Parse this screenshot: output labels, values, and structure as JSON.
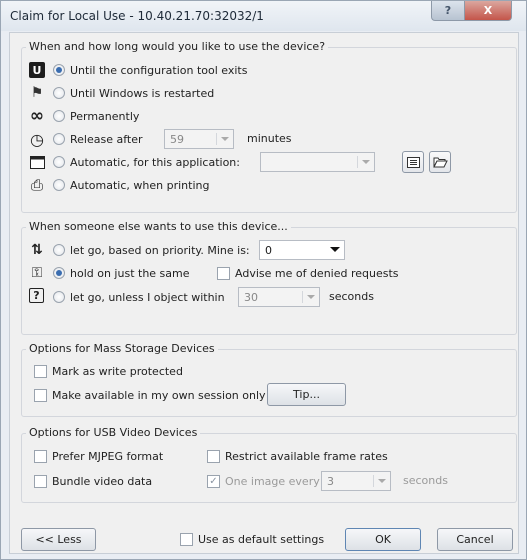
{
  "window": {
    "title": "Claim for Local Use - 10.40.21.70:32032/1",
    "help_label": "?",
    "close_label": "X"
  },
  "usage": {
    "title": "When and how long would you like to use the device?",
    "until_tool_exits": "Until the configuration tool exits",
    "until_restart": "Until Windows is restarted",
    "permanently": "Permanently",
    "release_after": "Release after",
    "release_minutes_value": "59",
    "minutes_label": "minutes",
    "auto_app": "Automatic, for this application:",
    "app_value": "",
    "auto_printing": "Automatic, when printing",
    "selected": "until_tool_exits"
  },
  "contention": {
    "title": "When someone else wants to use this device...",
    "priority": "let go, based on priority. Mine is:",
    "priority_value": "0",
    "hold_on": "hold on just the same",
    "advise": "Advise me of denied requests",
    "unless_object": "let go, unless I object within",
    "object_seconds_value": "30",
    "seconds_label": "seconds",
    "selected": "hold_on"
  },
  "mass_storage": {
    "title": "Options for Mass Storage Devices",
    "write_protected": "Mark as write protected",
    "own_session": "Make available in my own session only",
    "tip_button": "Tip..."
  },
  "usb_video": {
    "title": "Options for USB Video Devices",
    "mjpeg": "Prefer MJPEG format",
    "restrict_rates": "Restrict available frame rates",
    "bundle": "Bundle video data",
    "one_image_every": "One image every",
    "one_image_value": "3",
    "seconds_label": "seconds"
  },
  "footer": {
    "less_button": "<< Less",
    "default_settings": "Use as default settings",
    "ok_button": "OK",
    "cancel_button": "Cancel"
  },
  "icons": {
    "tool": "U",
    "windows": "⚑",
    "infinity": "∞",
    "clock": "◷",
    "application": "▭",
    "printer": "⎙",
    "priority": "⇅",
    "hold": "⚿",
    "object": "?",
    "checkmark": "✓"
  },
  "colors": {
    "radio_dot": "#3a6db0",
    "close_button": "#c4554a"
  }
}
